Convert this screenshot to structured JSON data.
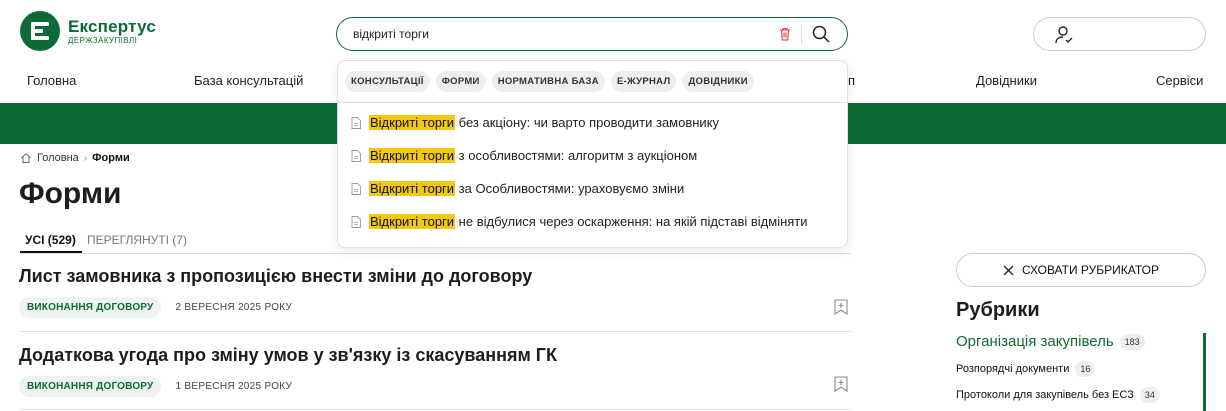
{
  "brand": {
    "title": "Експертус",
    "subtitle": "ДЕРЖЗАКУПІВЛІ",
    "color": "#0d6b37"
  },
  "search": {
    "value": "відкриті торги",
    "placeholder": ""
  },
  "nav": {
    "items": [
      "Головна",
      "База консультацій",
      "п",
      "Довідники",
      "Сервіси"
    ]
  },
  "breadcrumb": {
    "home": "Головна",
    "current": "Форми"
  },
  "page": {
    "title": "Форми"
  },
  "tabs": {
    "all": "УСІ (529)",
    "viewed": "ПЕРЕГЛЯНУТІ (7)"
  },
  "articles": [
    {
      "title": "Лист замовника з пропозицією внести зміни до договору",
      "tag": "ВИКОНАННЯ ДОГОВОРУ",
      "date": "2 ВЕРЕСНЯ 2025 РОКУ"
    },
    {
      "title": "Додаткова угода про зміну умов у зв'язку із скасуванням ГК",
      "tag": "ВИКОНАННЯ ДОГОВОРУ",
      "date": "1 ВЕРЕСНЯ 2025 РОКУ"
    }
  ],
  "sidebar": {
    "hide_button": "СХОВАТИ РУБРИКАТОР",
    "title": "Рубрики",
    "rubrics": [
      {
        "label": "Організація закупівель",
        "count": "183"
      },
      {
        "label": "Розпорядчі документи",
        "count": "16"
      },
      {
        "label": "Протоколи для закупівель без ЕСЗ",
        "count": "34"
      }
    ]
  },
  "dropdown": {
    "chips": [
      "КОНСУЛЬТАЦІЇ",
      "ФОРМИ",
      "НОРМАТИВНА БАЗА",
      "Е-ЖУРНАЛ",
      "ДОВІДНИКИ"
    ],
    "highlight": "Відкриті торги",
    "suggestions": [
      " без акціону: чи варто проводити замовнику",
      " з особливостями: алгоритм з аукціоном",
      " за Особливостями: ураховуємо зміни",
      " не відбулися через оскарження: на якій підставі відміняти"
    ]
  },
  "colors": {
    "accent": "#0d6b37",
    "highlight": "#f2c811"
  }
}
